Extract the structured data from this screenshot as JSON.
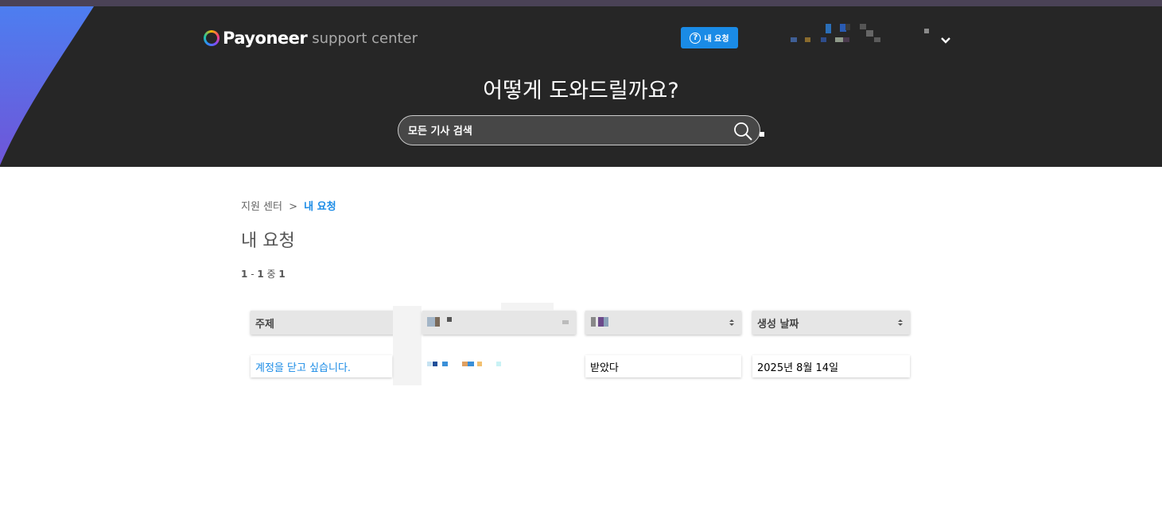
{
  "header": {
    "brand_name": "Payoneer",
    "brand_sub": "support center",
    "my_requests_button": "내 요청",
    "headline": "어떻게 도와드릴까요?",
    "search_placeholder": "모든 기사 검색"
  },
  "breadcrumb": {
    "root": "지원 센터",
    "separator": ">",
    "current": "내 요청"
  },
  "page": {
    "title": "내 요청",
    "count": {
      "from": "1",
      "dash": "-",
      "to": "1",
      "of": "중",
      "total": "1"
    }
  },
  "table": {
    "columns": [
      "주제",
      "",
      "",
      "생성 날짜"
    ],
    "rows": [
      {
        "subject": "계정을 닫고 싶습니다.",
        "status": "받았다",
        "created": "2025년 8월 14일"
      }
    ]
  },
  "colors": {
    "accent": "#1a8be6",
    "hero_bg": "#262626"
  }
}
